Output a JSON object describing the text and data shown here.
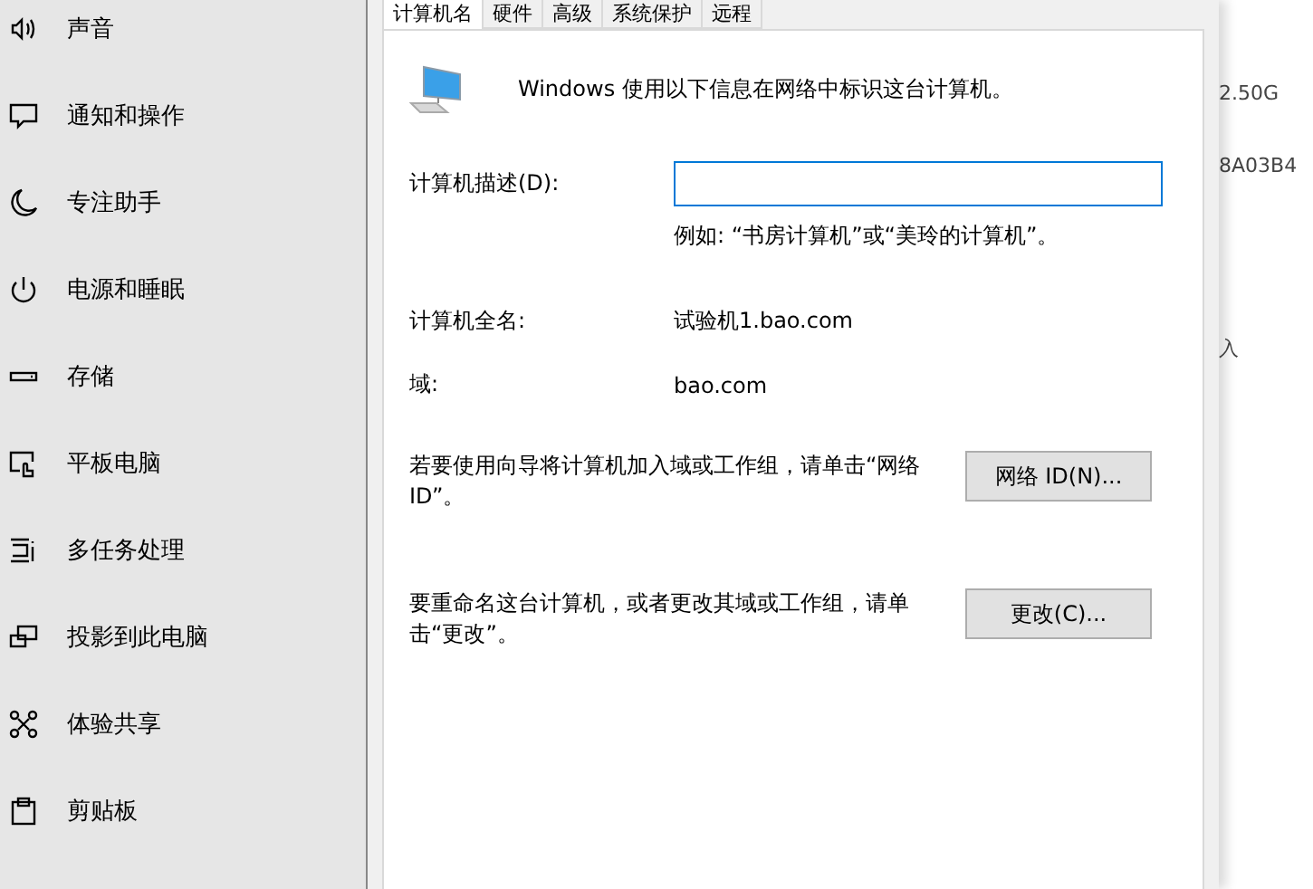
{
  "sidebar": {
    "items": [
      {
        "label": "声音",
        "selected": false
      },
      {
        "label": "通知和操作",
        "selected": false
      },
      {
        "label": "专注助手",
        "selected": false
      },
      {
        "label": "电源和睡眠",
        "selected": false
      },
      {
        "label": "存储",
        "selected": false
      },
      {
        "label": "平板电脑",
        "selected": false
      },
      {
        "label": "多任务处理",
        "selected": false
      },
      {
        "label": "投影到此电脑",
        "selected": false
      },
      {
        "label": "体验共享",
        "selected": false
      },
      {
        "label": "剪贴板",
        "selected": false
      }
    ]
  },
  "dialog": {
    "tabs": [
      {
        "label": "计算机名",
        "selected": true
      },
      {
        "label": "硬件",
        "selected": false
      },
      {
        "label": "高级",
        "selected": false
      },
      {
        "label": "系统保护",
        "selected": false
      },
      {
        "label": "远程",
        "selected": false
      }
    ],
    "intro": "Windows 使用以下信息在网络中标识这台计算机。",
    "description": {
      "label": "计算机描述(D):",
      "example": "例如: “书房计算机”或“美玲的计算机”。"
    },
    "info": [
      {
        "label": "计算机全名:",
        "value": "试验机1.bao.com"
      },
      {
        "label": "域:",
        "value": "bao.com"
      }
    ],
    "actions": [
      {
        "text": "若要使用向导将计算机加入域或工作组，请单击“网络 ID”。",
        "button": "网络 ID(N)..."
      },
      {
        "text": "要重命名这台计算机，或者更改其域或工作组，请单击“更改”。",
        "button": "更改(C)..."
      }
    ]
  },
  "background": {
    "texts": [
      "2.50G",
      "8A03B4",
      "入"
    ]
  }
}
